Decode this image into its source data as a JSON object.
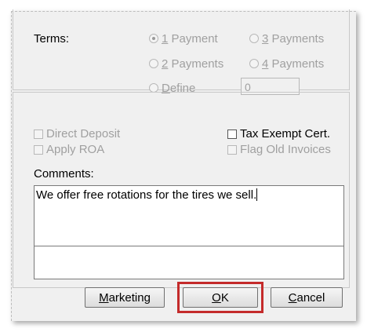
{
  "terms": {
    "label": "Terms:",
    "options": [
      {
        "pre": "",
        "key": "1",
        "rest": " Payment",
        "selected": true
      },
      {
        "pre": "",
        "key": "3",
        "rest": " Payments",
        "selected": false
      },
      {
        "pre": "",
        "key": "2",
        "rest": " Payments",
        "selected": false
      },
      {
        "pre": "",
        "key": "4",
        "rest": " Payments",
        "selected": false
      },
      {
        "pre": "",
        "key": "D",
        "rest": "efine",
        "selected": false
      }
    ],
    "define_value": "0"
  },
  "options": {
    "direct_deposit": "Direct Deposit",
    "apply_roa": "Apply ROA",
    "tax_exempt": "Tax Exempt Cert.",
    "flag_old_invoices": "Flag Old Invoices"
  },
  "comments": {
    "label": "Comments:",
    "text": "We offer free rotations for the tires we sell."
  },
  "buttons": {
    "marketing": {
      "key": "M",
      "rest": "arketing"
    },
    "ok": {
      "key": "O",
      "rest": "K"
    },
    "cancel": {
      "key": "C",
      "rest": "ancel"
    }
  },
  "colors": {
    "highlight": "#c42b2b"
  }
}
